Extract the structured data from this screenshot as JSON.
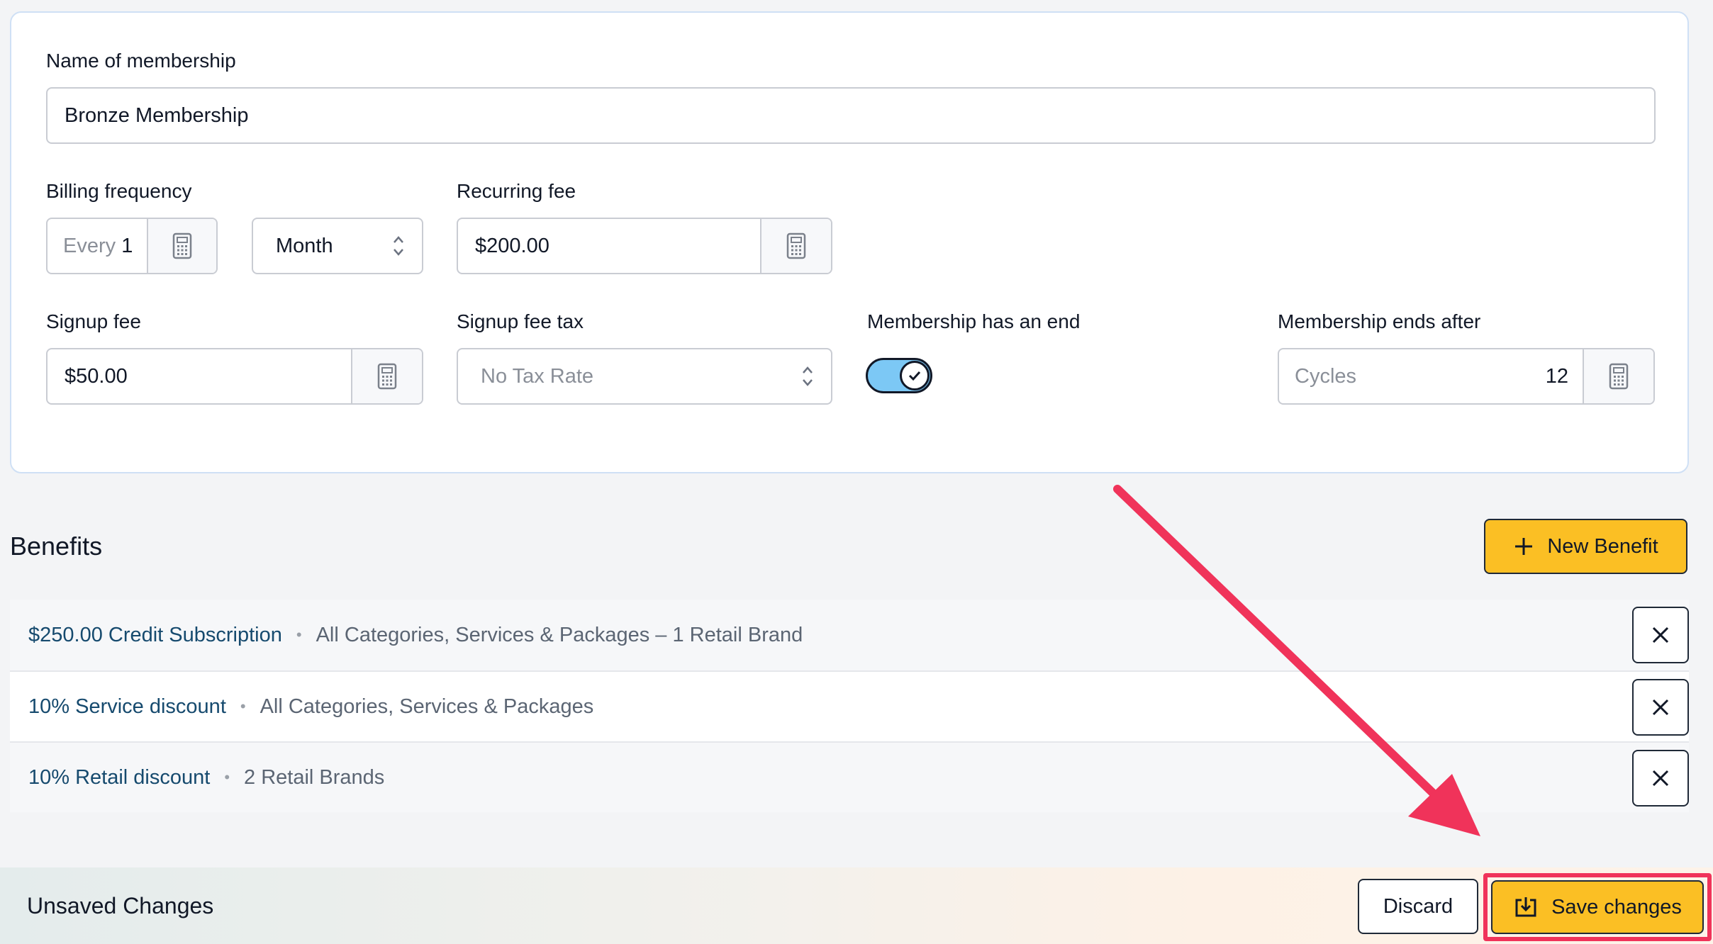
{
  "form": {
    "name_label": "Name of membership",
    "name_value": "Bronze Membership",
    "billing_label": "Billing frequency",
    "billing_every_prefix": "Every",
    "billing_every_value": "1",
    "billing_period": "Month",
    "recurring_label": "Recurring fee",
    "recurring_value": "$200.00",
    "signup_label": "Signup fee",
    "signup_value": "$50.00",
    "signup_tax_label": "Signup fee tax",
    "signup_tax_placeholder": "No Tax Rate",
    "has_end_label": "Membership has an end",
    "has_end_on": true,
    "ends_after_label": "Membership ends after",
    "ends_after_prefix": "Cycles",
    "ends_after_value": "12"
  },
  "benefits": {
    "title": "Benefits",
    "new_button_label": "New Benefit",
    "items": [
      {
        "name": "$250.00 Credit Subscription",
        "description": "All Categories, Services & Packages – 1 Retail Brand"
      },
      {
        "name": "10% Service discount",
        "description": "All Categories, Services & Packages"
      },
      {
        "name": "10% Retail discount",
        "description": "2 Retail Brands"
      }
    ]
  },
  "footer": {
    "title": "Unsaved Changes",
    "discard_label": "Discard",
    "save_label": "Save changes"
  },
  "colors": {
    "accent": "#fbbf24",
    "link": "#164a6e",
    "toggle_on": "#7cc8f5",
    "annotation": "#f0335a"
  }
}
